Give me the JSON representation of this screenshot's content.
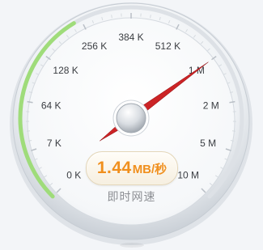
{
  "gauge": {
    "ticks": [
      {
        "label": "0 K"
      },
      {
        "label": "7 K"
      },
      {
        "label": "64 K"
      },
      {
        "label": "128 K"
      },
      {
        "label": "256 K"
      },
      {
        "label": "384 K"
      },
      {
        "label": "512 K"
      },
      {
        "label": "1 M"
      },
      {
        "label": "2 M"
      },
      {
        "label": "5 M"
      },
      {
        "label": "10 M"
      }
    ],
    "speed_value": "1.44",
    "speed_unit": "MB/秒",
    "caption": "即时网速",
    "needle_tick_fraction": 0.7,
    "colors": {
      "progress_arc": "#9fdc7a",
      "needle": "#d71920",
      "speed_text": "#f08f1d",
      "tick_text": "#3a3d42"
    }
  }
}
